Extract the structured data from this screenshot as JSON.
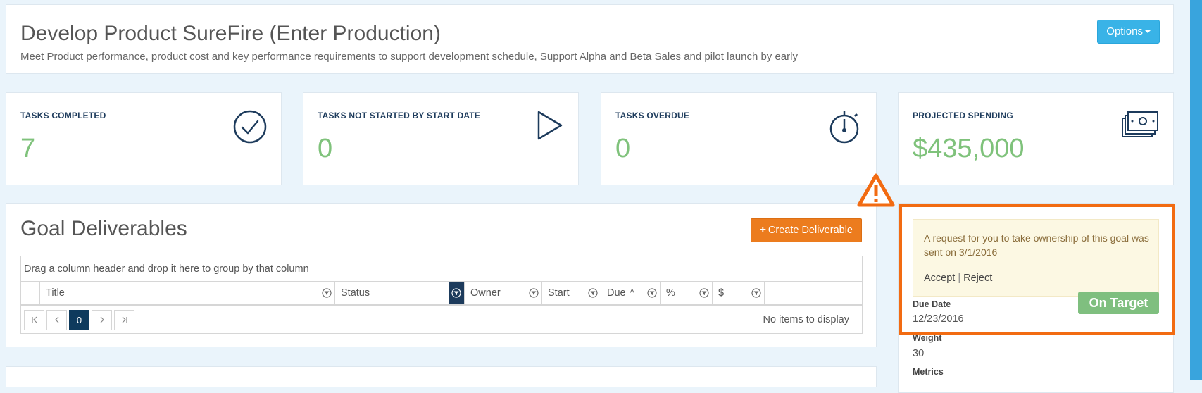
{
  "header": {
    "title": "Develop Product SureFire (Enter Production)",
    "description": "Meet Product performance, product cost and key performance requirements to support development schedule, Support Alpha and Beta Sales and pilot launch by early",
    "options_label": "Options"
  },
  "stats": [
    {
      "label": "TASKS COMPLETED",
      "value": "7",
      "icon": "check-circle-icon"
    },
    {
      "label": "TASKS NOT STARTED BY START DATE",
      "value": "0",
      "icon": "play-icon"
    },
    {
      "label": "TASKS OVERDUE",
      "value": "0",
      "icon": "stopwatch-icon"
    },
    {
      "label": "PROJECTED SPENDING",
      "value": "$435,000",
      "icon": "money-icon"
    }
  ],
  "deliverables": {
    "title": "Goal Deliverables",
    "create_label": "Create Deliverable",
    "group_hint": "Drag a column header and drop it here to group by that column",
    "columns": [
      "Title",
      "Status",
      "Owner",
      "Start",
      "Due",
      "%",
      "$"
    ],
    "pager_page": "0",
    "no_items": "No items to display"
  },
  "request": {
    "text": "A request for you to take ownership of this goal was sent on 3/1/2016",
    "accept_label": "Accept",
    "separator": "|",
    "reject_label": "Reject"
  },
  "status_badge": "On Target",
  "details": {
    "due_date_label": "Due Date",
    "due_date_value": "12/23/2016",
    "weight_label": "Weight",
    "weight_value": "30",
    "metrics_label": "Metrics"
  },
  "colors": {
    "accent_blue": "#39b3e7",
    "orange": "#ec7c1e",
    "highlight": "#f26b12",
    "value_green": "#7fc27b",
    "navy": "#1d3b5c"
  }
}
